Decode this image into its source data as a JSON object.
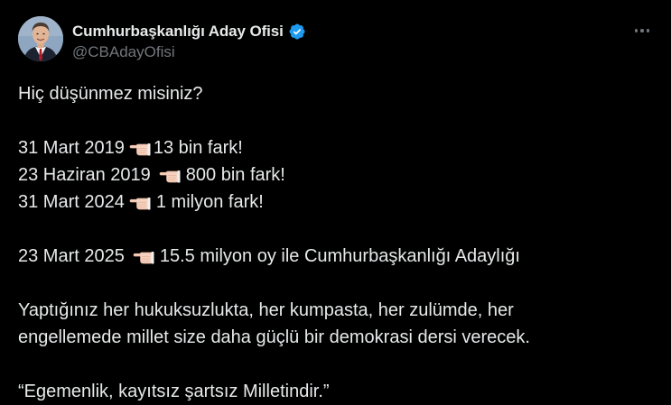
{
  "author": {
    "display_name": "Cumhurbaşkanlığı Aday Ofisi",
    "handle": "@CBAdayOfisi",
    "verified": true
  },
  "icons": {
    "verified": "verified-badge-icon",
    "more": "more-horizontal-icon",
    "pointer": "backhand-index-pointing-left-emoji"
  },
  "colors": {
    "background": "#000000",
    "text": "#e7e9ea",
    "muted": "#71767b",
    "verified": "#1d9bf0"
  },
  "tweet": {
    "question": "Hiç düşünmez misiniz?",
    "items": [
      {
        "date": "31 Mart 2019",
        "result": "13 bin fark!"
      },
      {
        "date": "23 Haziran 2019",
        "result": "800 bin fark!"
      },
      {
        "date": "31 Mart 2024",
        "result": "1 milyon fark!"
      }
    ],
    "highlight": {
      "date": "23 Mart 2025",
      "result": "15.5 milyon oy ile Cumhurbaşkanlığı Adaylığı"
    },
    "paragraph": "Yaptığınız her hukuksuzlukta, her kumpasta, her zulümde, her engellemede millet size daha güçlü bir demokrasi dersi verecek.",
    "quote": "“Egemenlik, kayıtsız şartsız Milletindir.”"
  }
}
